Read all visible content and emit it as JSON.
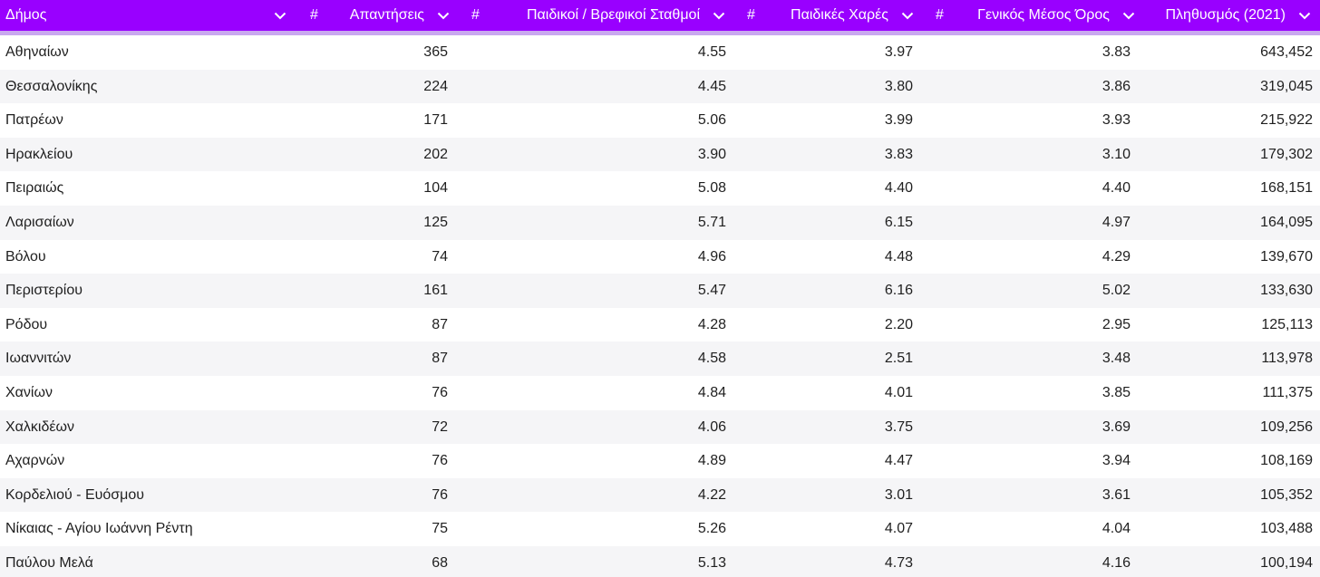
{
  "colors": {
    "header_bg": "#9900ff",
    "header_text": "#ffffff",
    "header_underline": "#c9a8ef",
    "row_alt_bg": "#f5f5f7"
  },
  "header": {
    "columns": [
      {
        "label": "Δήμος",
        "type": "text",
        "icon": "chevron-down-icon"
      },
      {
        "label": "Απαντήσεις",
        "type": "number",
        "hash": "#",
        "icon": "chevron-down-icon"
      },
      {
        "label": "Παιδικοί / Βρεφικοί Σταθμοί",
        "type": "number",
        "hash": "#",
        "icon": "chevron-down-icon"
      },
      {
        "label": "Παιδικές Χαρές",
        "type": "number",
        "hash": "#",
        "icon": "chevron-down-icon"
      },
      {
        "label": "Γενικός Μέσος Όρος",
        "type": "number",
        "hash": "#",
        "icon": "chevron-down-icon"
      },
      {
        "label": "Πληθυσμός (2021)",
        "type": "text",
        "icon": "chevron-down-icon"
      }
    ]
  },
  "rows": [
    [
      "Αθηναίων",
      "365",
      "4.55",
      "3.97",
      "3.83",
      "643,452"
    ],
    [
      "Θεσσαλονίκης",
      "224",
      "4.45",
      "3.80",
      "3.86",
      "319,045"
    ],
    [
      "Πατρέων",
      "171",
      "5.06",
      "3.99",
      "3.93",
      "215,922"
    ],
    [
      "Ηρακλείου",
      "202",
      "3.90",
      "3.83",
      "3.10",
      "179,302"
    ],
    [
      "Πειραιώς",
      "104",
      "5.08",
      "4.40",
      "4.40",
      "168,151"
    ],
    [
      "Λαρισαίων",
      "125",
      "5.71",
      "6.15",
      "4.97",
      "164,095"
    ],
    [
      "Βόλου",
      "74",
      "4.96",
      "4.48",
      "4.29",
      "139,670"
    ],
    [
      "Περιστερίου",
      "161",
      "5.47",
      "6.16",
      "5.02",
      "133,630"
    ],
    [
      "Ρόδου",
      "87",
      "4.28",
      "2.20",
      "2.95",
      "125,113"
    ],
    [
      "Ιωαννιτών",
      "87",
      "4.58",
      "2.51",
      "3.48",
      "113,978"
    ],
    [
      "Χανίων",
      "76",
      "4.84",
      "4.01",
      "3.85",
      "111,375"
    ],
    [
      "Χαλκιδέων",
      "72",
      "4.06",
      "3.75",
      "3.69",
      "109,256"
    ],
    [
      "Αχαρνών",
      "76",
      "4.89",
      "4.47",
      "3.94",
      "108,169"
    ],
    [
      "Κορδελιού - Ευόσμου",
      "76",
      "4.22",
      "3.01",
      "3.61",
      "105,352"
    ],
    [
      "Νίκαιας - Αγίου Ιωάννη Ρέντη",
      "75",
      "5.26",
      "4.07",
      "4.04",
      "103,488"
    ],
    [
      "Παύλου Μελά",
      "68",
      "5.13",
      "4.73",
      "4.16",
      "100,194"
    ]
  ]
}
